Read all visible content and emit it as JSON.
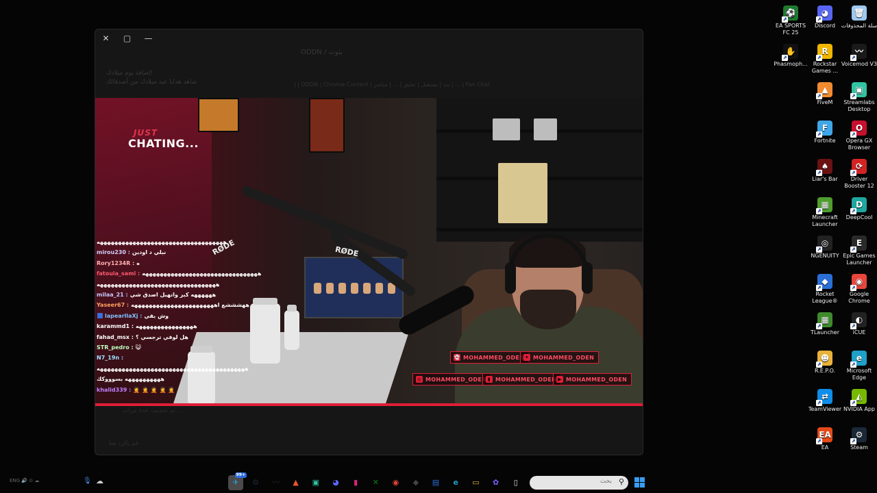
{
  "desktop_icons": [
    {
      "label": "EA SPORTS FC 25",
      "icon": "ea-fc-icon",
      "color": "#1e7a2e",
      "glyph": "⚽"
    },
    {
      "label": "Discord",
      "icon": "discord-icon",
      "color": "#5865f2",
      "glyph": "◕"
    },
    {
      "label": "سلة المحذوفات",
      "icon": "recycle-bin-icon",
      "color": "#9ec9ef",
      "glyph": "🗑"
    },
    {
      "label": "Phasmoph...",
      "icon": "phasmophobia-icon",
      "color": "#111111",
      "glyph": "✋"
    },
    {
      "label": "Rockstar Games ...",
      "icon": "rockstar-icon",
      "color": "#f0b600",
      "glyph": "R"
    },
    {
      "label": "Voicemod V3",
      "icon": "voicemod-icon",
      "color": "#1a1a1a",
      "glyph": "〰"
    },
    {
      "label": "FiveM",
      "icon": "fivem-icon",
      "color": "#f28b30",
      "glyph": "▲"
    },
    {
      "label": "Streamlabs Desktop",
      "icon": "streamlabs-icon",
      "color": "#31c3a2",
      "glyph": "▣"
    },
    {
      "label": "Fortnite",
      "icon": "fortnite-icon",
      "color": "#3fa7e8",
      "glyph": "F"
    },
    {
      "label": "Opera GX Browser",
      "icon": "opera-gx-icon",
      "color": "#c8102e",
      "glyph": "O"
    },
    {
      "label": "Liar's Bar",
      "icon": "liars-bar-icon",
      "color": "#6b1212",
      "glyph": "♠"
    },
    {
      "label": "Driver Booster 12",
      "icon": "driver-booster-icon",
      "color": "#d32323",
      "glyph": "⟳"
    },
    {
      "label": "Minecraft Launcher",
      "icon": "minecraft-icon",
      "color": "#4f9e2f",
      "glyph": "▦"
    },
    {
      "label": "DeepCool",
      "icon": "deepcool-icon",
      "color": "#1fa7a0",
      "glyph": "D"
    },
    {
      "label": "NGENUITY",
      "icon": "ngenuity-icon",
      "color": "#222222",
      "glyph": "◎"
    },
    {
      "label": "Epic Games Launcher",
      "icon": "epic-games-icon",
      "color": "#2a2a2a",
      "glyph": "E"
    },
    {
      "label": "Rocket League®",
      "icon": "rocket-league-icon",
      "color": "#2a6fd6",
      "glyph": "◆"
    },
    {
      "label": "Google Chrome",
      "icon": "chrome-icon",
      "color": "#e8453c",
      "glyph": "◉"
    },
    {
      "label": "TLauncher",
      "icon": "tlauncher-icon",
      "color": "#3f8a2c",
      "glyph": "▦"
    },
    {
      "label": "iCUE",
      "icon": "icue-icon",
      "color": "#222222",
      "glyph": "◐"
    },
    {
      "label": "R.E.P.O.",
      "icon": "repo-icon",
      "color": "#e9b23a",
      "glyph": "☻"
    },
    {
      "label": "Microsoft Edge",
      "icon": "edge-icon",
      "color": "#1fa0c8",
      "glyph": "e"
    },
    {
      "label": "TeamViewer",
      "icon": "teamviewer-icon",
      "color": "#0e8ee9",
      "glyph": "⇄"
    },
    {
      "label": "NVIDIA App",
      "icon": "nvidia-icon",
      "color": "#76b900",
      "glyph": "◭"
    },
    {
      "label": "EA",
      "icon": "ea-icon",
      "color": "#e64a19",
      "glyph": "EA"
    },
    {
      "label": "Steam",
      "icon": "steam-icon",
      "color": "#1b2838",
      "glyph": "⚙"
    }
  ],
  "window": {
    "close": "✕",
    "maximize": "▢",
    "minimize": "—",
    "ghost_title": "ODDN / بثوث",
    "ghost_notice_title": "إضافة يوم ميلادك!",
    "ghost_notice_sub": "شاهد هدايا عيد ميلادك من أصدقائك",
    "ghost_breadcrumbs": "| | ODDN | Chrome Content | بث | يستقبل | تعليق | ... | مباشر | ... | Fan Chat",
    "ghost_footer1": "تم تحديث عدة مرات ...",
    "ghost_footer2": "قم بالرد هنا"
  },
  "stream": {
    "just_label": "JUST",
    "title": "CHATING...",
    "rode_1": "RØDE",
    "rode_2": "RØDE",
    "chat": [
      {
        "name": "",
        "msg": "هههههههههههههههههههههههههههههههههههه",
        "color": "#ffffff"
      },
      {
        "name": "mirou230 :",
        "msg": "نبلي د اودين",
        "color": "#d0d0ff"
      },
      {
        "name": "Rory1234R :",
        "msg": "ه",
        "color": "#ffb0b0"
      },
      {
        "name": "fatouia_sami :",
        "msg": "ههههههههههههههههههههههههههههههههه",
        "color": "#ff5a6e"
      },
      {
        "name": "",
        "msg": "هههههههههههههههههههههههههههههههههه",
        "color": "#ffffff"
      },
      {
        "name": "milaa_21 :",
        "msg": "ههههههه كبر واتهبل اصدق شي",
        "color": "#c8c8ff"
      },
      {
        "name": "Yaseer67 :",
        "msg": "ههشششع اهههههههههههههههههههههههه",
        "color": "#ffa060"
      },
      {
        "name": "lapearllaXj :",
        "msg": "وش بقي",
        "color": "#80c0ff",
        "badge": true
      },
      {
        "name": "karammd1 :",
        "msg": "ههههههههههههههههه",
        "color": "#ffffff"
      },
      {
        "name": "fahad_msx :",
        "msg": "هل لوفي ترجسي ؟",
        "color": "#ffffff"
      },
      {
        "name": "STR_pedro :",
        "msg": "😺",
        "color": "#c0ffc0"
      },
      {
        "name": "N7_19n :",
        "msg": "",
        "color": "#a0e0ff"
      },
      {
        "name": "",
        "msg": "هههههههههههههههههههههههههههههههههههههههههه",
        "color": "#ffffff"
      },
      {
        "name": "",
        "msg": "ههههههههههه بسوووكك",
        "color": "#ffffff"
      },
      {
        "name": "khalid339 :",
        "msg": "🤦 🤦 🤦 🤦 🤦",
        "color": "#c080ff"
      }
    ],
    "socials": [
      {
        "label": "MOHAMMED_ODEN",
        "icon": "snapchat-icon",
        "glyph": "👻"
      },
      {
        "label": "MOHAMMED_ODEN",
        "icon": "twitter-icon",
        "glyph": "✦"
      },
      {
        "label": "MOHAMMED_ODEN",
        "icon": "instagram-icon",
        "glyph": "◎"
      },
      {
        "label": "MOHAMMED_ODEN",
        "icon": "twitch-icon",
        "glyph": "▮"
      },
      {
        "label": "MOHAMMED_ODEN",
        "icon": "youtube-icon",
        "glyph": "▶"
      }
    ]
  },
  "taskbar": {
    "left_text": "ENG  🔊  ⊙  ☁",
    "weather_glyph": "☁",
    "mic_glyph": "🎙",
    "apps": [
      {
        "icon": "telegram-icon",
        "glyph": "✈",
        "color": "#2a9fd6",
        "badge": "99+",
        "active": true
      },
      {
        "icon": "steam-taskbar-icon",
        "glyph": "⚙",
        "color": "#1b2838"
      },
      {
        "icon": "voicemod-taskbar-icon",
        "glyph": "〰",
        "color": "#1a1a1a"
      },
      {
        "icon": "brave-icon",
        "glyph": "▲",
        "color": "#f0562b"
      },
      {
        "icon": "streamlabs-taskbar-icon",
        "glyph": "▣",
        "color": "#31c3a2"
      },
      {
        "icon": "discord-taskbar-icon",
        "glyph": "◕",
        "color": "#5865f2"
      },
      {
        "icon": "app-pink-icon",
        "glyph": "▮",
        "color": "#d6247a"
      },
      {
        "icon": "xbox-icon",
        "glyph": "✕",
        "color": "#107c10"
      },
      {
        "icon": "chrome-taskbar-icon",
        "glyph": "◉",
        "color": "#e8453c"
      },
      {
        "icon": "app-cube-icon",
        "glyph": "◆",
        "color": "#444444"
      },
      {
        "icon": "store-icon",
        "glyph": "▤",
        "color": "#2a6fd6"
      },
      {
        "icon": "edge-taskbar-icon",
        "glyph": "e",
        "color": "#1fa0c8"
      },
      {
        "icon": "file-explorer-icon",
        "glyph": "▭",
        "color": "#e8b93a"
      },
      {
        "icon": "copilot-icon",
        "glyph": "✿",
        "color": "#7b61ff"
      },
      {
        "icon": "notepad-icon",
        "glyph": "▯",
        "color": "#e0e0e0"
      }
    ],
    "search_placeholder": "بحث",
    "search_glyph": "⚲"
  }
}
